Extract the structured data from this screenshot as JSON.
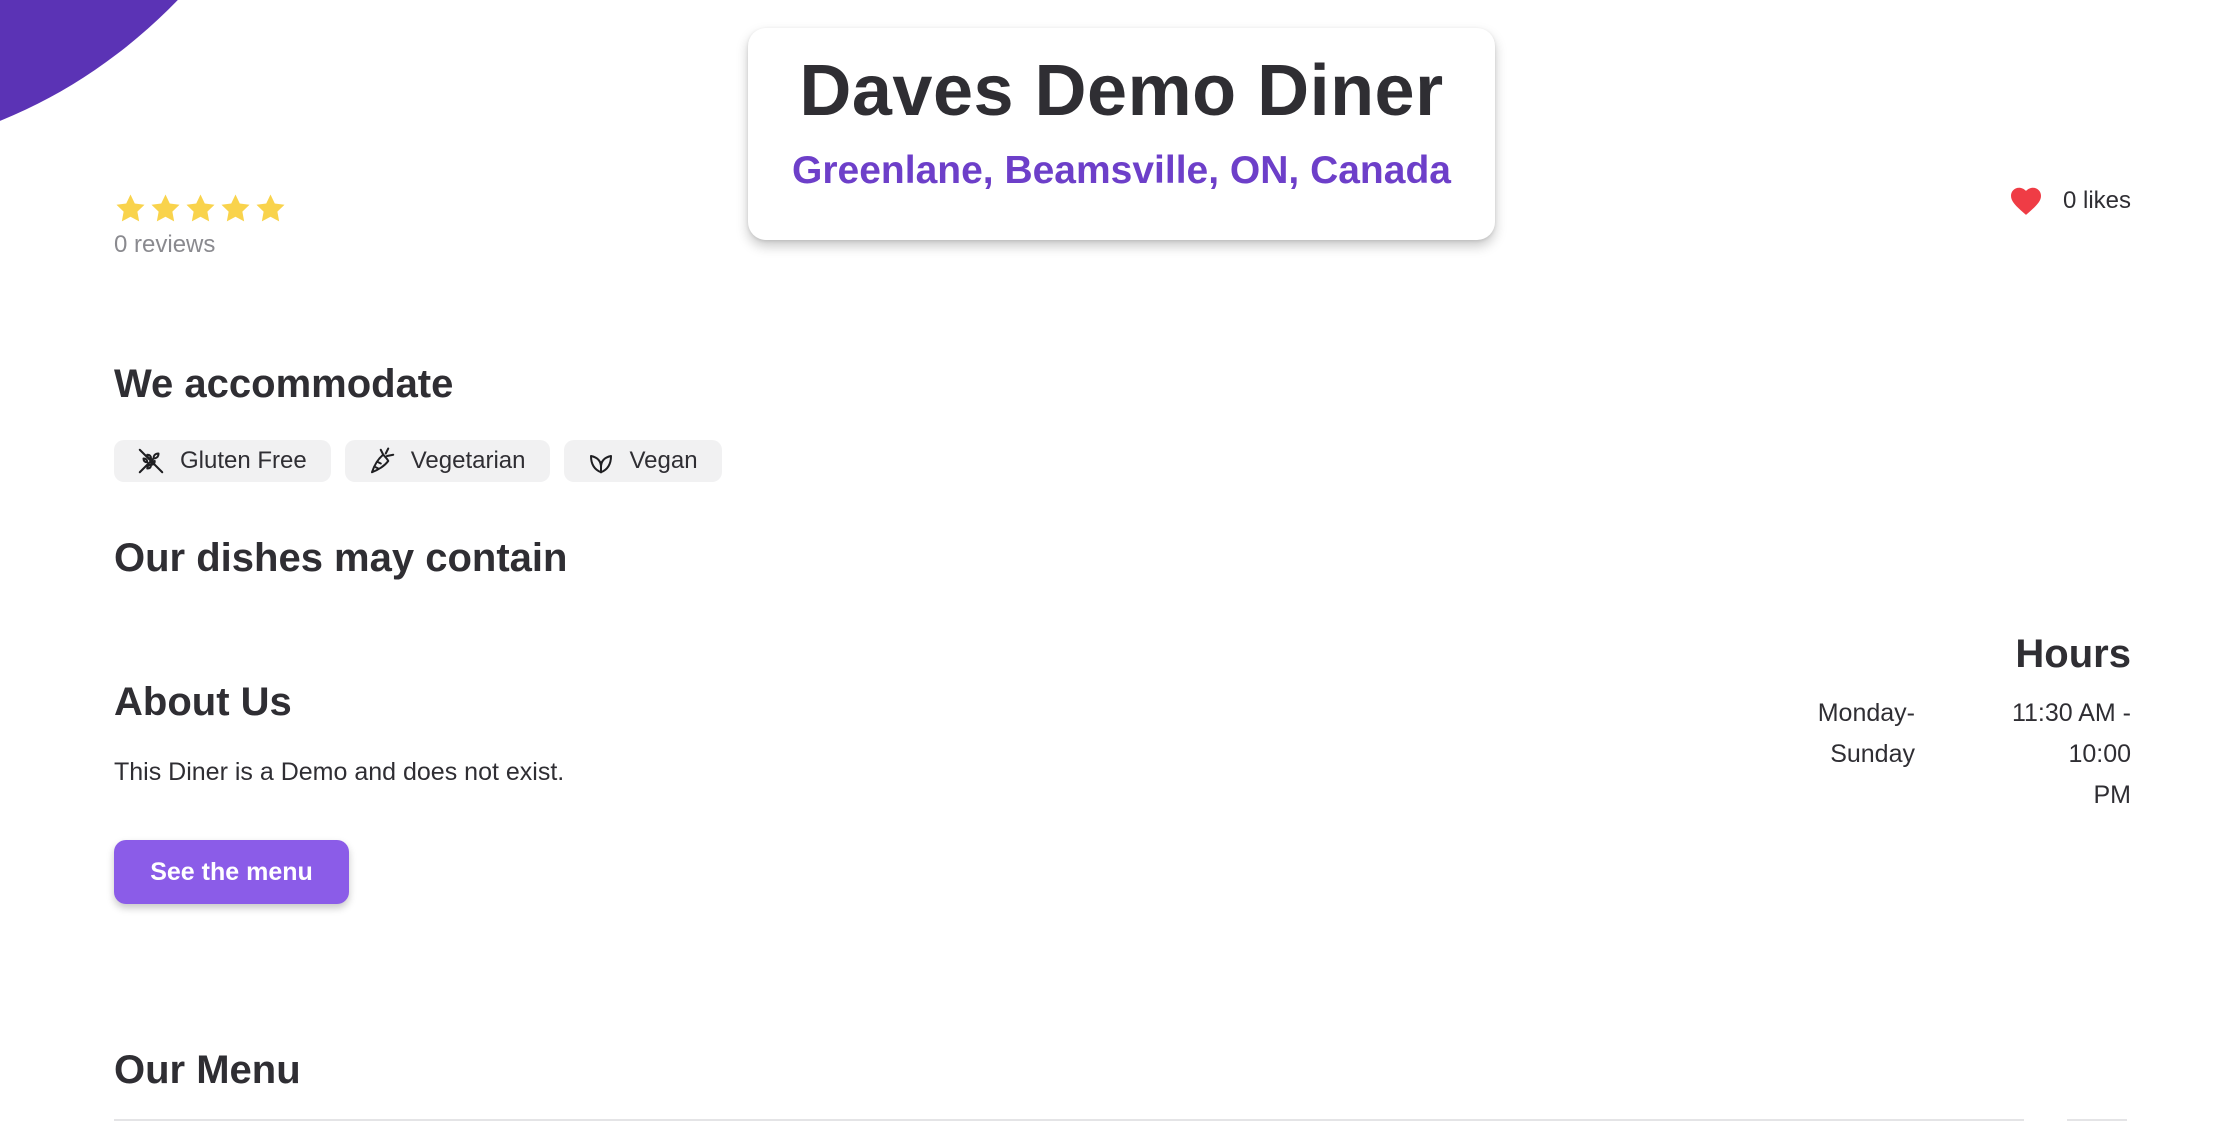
{
  "restaurant": {
    "name": "Daves Demo Diner",
    "location": "Greenlane, Beamsville, ON, Canada"
  },
  "rating": {
    "stars": 5,
    "reviews_label": "0 reviews"
  },
  "likes": {
    "label": "0 likes"
  },
  "accommodate": {
    "heading": "We accommodate",
    "items": [
      {
        "label": "Gluten Free",
        "icon": "gluten-free-icon"
      },
      {
        "label": "Vegetarian",
        "icon": "carrot-icon"
      },
      {
        "label": "Vegan",
        "icon": "leaf-icon"
      }
    ]
  },
  "allergens": {
    "heading": "Our dishes may contain"
  },
  "about": {
    "heading": "About Us",
    "text": "This Diner is a Demo and does not exist."
  },
  "menu_button": {
    "label": "See the menu"
  },
  "hours": {
    "heading": "Hours",
    "rows": [
      {
        "day_line1": "Monday-",
        "day_line2": "Sunday",
        "time_line1": "11:30 AM - 10:00",
        "time_line2": "PM"
      }
    ]
  },
  "menu": {
    "heading": "Our Menu"
  },
  "colors": {
    "brand_purple": "#5b33b5",
    "location_purple": "#6d3fc9",
    "button_purple": "#8b5ce8",
    "star_yellow": "#f9d34c",
    "heart_red": "#ef3c45",
    "text_dark": "#2f2e33"
  }
}
